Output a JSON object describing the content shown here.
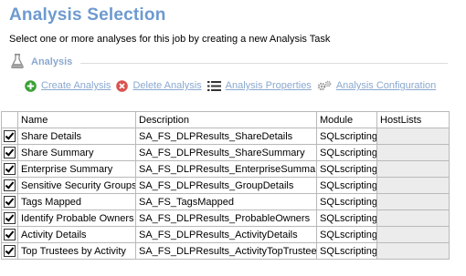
{
  "header": {
    "title": "Analysis Selection",
    "subtitle": "Select one or more analyses for this job by creating a new Analysis Task"
  },
  "section": {
    "label": "Analysis",
    "icon": "flask-icon"
  },
  "toolbar": {
    "create_label": "Create Analysis",
    "delete_label": "Delete Analysis",
    "properties_label": "Analysis Properties",
    "configuration_label": "Analysis Configuration"
  },
  "table": {
    "columns": [
      "Name",
      "Description",
      "Module",
      "HostLists"
    ],
    "rows": [
      {
        "checked": true,
        "name": "Share Details",
        "description": "SA_FS_DLPResults_ShareDetails",
        "module": "SQLscripting",
        "hostlists": ""
      },
      {
        "checked": true,
        "name": "Share Summary",
        "description": "SA_FS_DLPResults_ShareSummary",
        "module": "SQLscripting",
        "hostlists": ""
      },
      {
        "checked": true,
        "name": "Enterprise Summary",
        "description": "SA_FS_DLPResults_EnterpriseSummary",
        "module": "SQLscripting",
        "hostlists": ""
      },
      {
        "checked": true,
        "name": "Sensitive Security Groups",
        "description": "SA_FS_DLPResults_GroupDetails",
        "module": "SQLscripting",
        "hostlists": ""
      },
      {
        "checked": true,
        "name": "Tags Mapped",
        "description": "SA_FS_TagsMapped",
        "module": "SQLscripting",
        "hostlists": ""
      },
      {
        "checked": true,
        "name": "Identify Probable Owners",
        "description": "SA_FS_DLPResults_ProbableOwners",
        "module": "SQLscripting",
        "hostlists": ""
      },
      {
        "checked": true,
        "name": "Activity Details",
        "description": "SA_FS_DLPResults_ActivityDetails",
        "module": "SQLscripting",
        "hostlists": ""
      },
      {
        "checked": true,
        "name": "Top Trustees by Activity",
        "description": "SA_FS_DLPResults_ActivityTopTrustees",
        "module": "SQLscripting",
        "hostlists": ""
      }
    ]
  },
  "colors": {
    "title": "#6d9ad0",
    "link": "#8aa8cf",
    "create_icon": "#3aa135",
    "delete_icon": "#d9534f",
    "host_cell": "#ececec"
  }
}
